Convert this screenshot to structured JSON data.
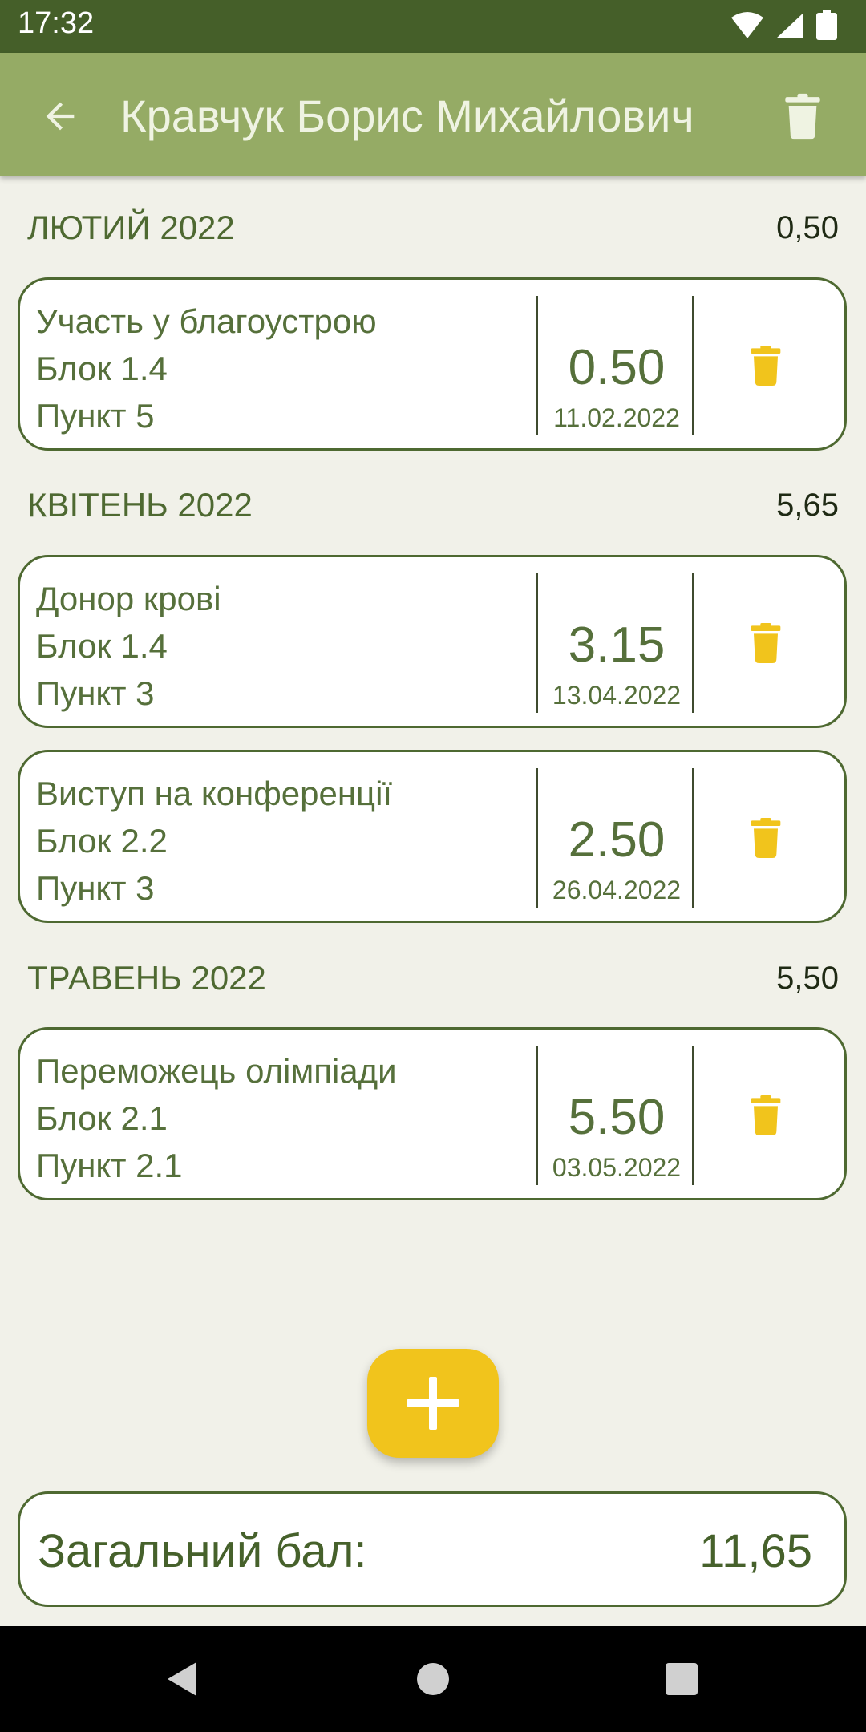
{
  "status_bar": {
    "time": "17:32",
    "icons": [
      "wifi-icon",
      "signal-icon",
      "battery-icon"
    ]
  },
  "app_bar": {
    "title": "Кравчук Борис Михайлович",
    "back_icon": "arrow-back-icon",
    "delete_icon": "trash-icon"
  },
  "colors": {
    "status_bar": "#455f29",
    "app_bar": "#95ab65",
    "background": "#f1f1e9",
    "accent_yellow": "#f1c41c",
    "text_green": "#56703b",
    "border_green": "#4e6931"
  },
  "sections": [
    {
      "month": "ЛЮТИЙ 2022",
      "total": "0,50",
      "items": [
        {
          "title": "Участь у благоустрою",
          "block": "Блок 1.4",
          "point": "Пункт 5",
          "score": "0.50",
          "date": "11.02.2022"
        }
      ]
    },
    {
      "month": "КВІТЕНЬ 2022",
      "total": "5,65",
      "items": [
        {
          "title": "Донор крові",
          "block": "Блок 1.4",
          "point": "Пункт 3",
          "score": "3.15",
          "date": "13.04.2022"
        },
        {
          "title": "Виступ на конференції",
          "block": "Блок 2.2",
          "point": "Пункт 3",
          "score": "2.50",
          "date": "26.04.2022"
        }
      ]
    },
    {
      "month": "ТРАВЕНЬ 2022",
      "total": "5,50",
      "items": [
        {
          "title": "Переможець олімпіади",
          "block": "Блок 2.1",
          "point": "Пункт 2.1",
          "score": "5.50",
          "date": "03.05.2022"
        }
      ]
    }
  ],
  "fab": {
    "icon": "plus-icon"
  },
  "total": {
    "label": "Загальний бал:",
    "value": "11,65"
  },
  "nav_bar": {
    "icons": [
      "back-triangle-icon",
      "home-circle-icon",
      "recents-square-icon"
    ]
  }
}
